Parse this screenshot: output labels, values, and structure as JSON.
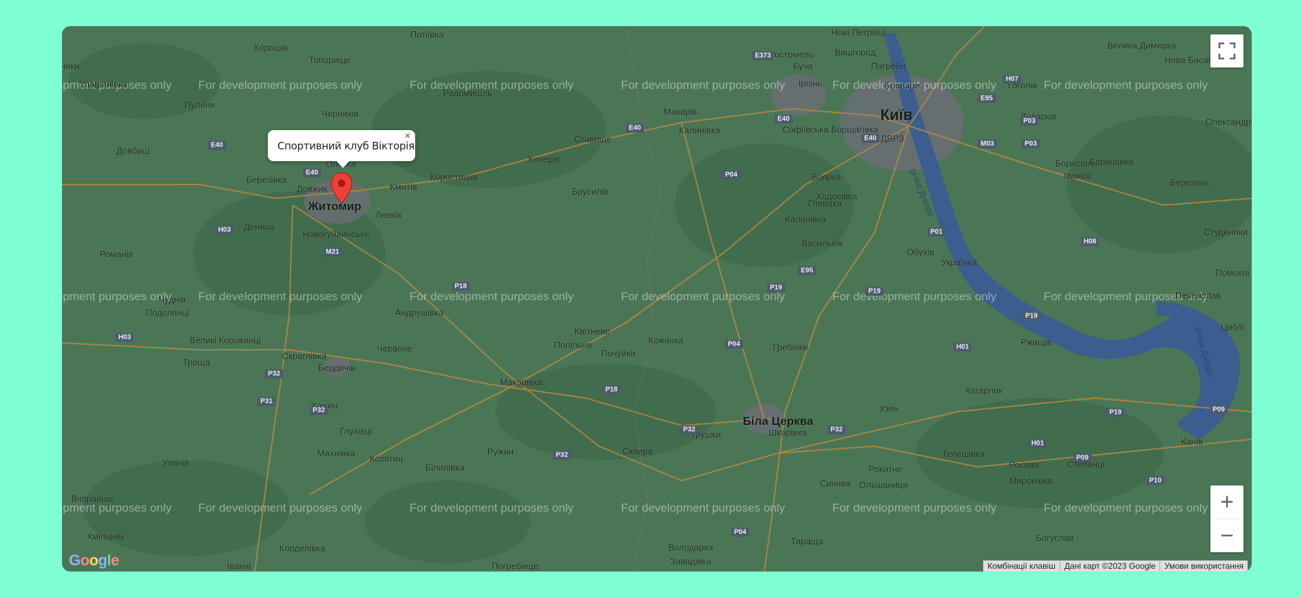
{
  "map": {
    "watermark": "For development purposes only",
    "colors": {
      "background": "#7fffd4",
      "land": "#4b7656",
      "water": "#3b5d8f",
      "urban": "#6d6d78",
      "road": "#b58a3e",
      "marker": "#ea4335"
    },
    "places": [
      {
        "name": "Потіївка",
        "type": "town"
      },
      {
        "name": "Хорошів",
        "type": "town"
      },
      {
        "name": "Топорище",
        "type": "town"
      },
      {
        "name": "Коростишів",
        "type": "town"
      },
      {
        "name": "Житомир",
        "type": "city"
      },
      {
        "name": "Київ",
        "type": "capital"
      },
      {
        "name": "Біла Церква",
        "type": "city"
      },
      {
        "name": "Нові Петрівці",
        "type": "town"
      },
      {
        "name": "Вишгород",
        "type": "town"
      },
      {
        "name": "Гостомель",
        "type": "town"
      },
      {
        "name": "Буча",
        "type": "town"
      },
      {
        "name": "Ірпінь",
        "type": "town"
      },
      {
        "name": "Погреби",
        "type": "town"
      },
      {
        "name": "Бровари",
        "type": "town"
      },
      {
        "name": "Велика Димерка",
        "type": "town"
      },
      {
        "name": "Нова Басань",
        "type": "town"
      },
      {
        "name": "Гоголів",
        "type": "town"
      },
      {
        "name": "Дударків",
        "type": "town"
      },
      {
        "name": "Софіївська Борщагівка",
        "type": "town"
      },
      {
        "name": "ДВРЗ",
        "type": "town"
      },
      {
        "name": "Бориспіль",
        "type": "town"
      },
      {
        "name": "Іванків",
        "type": "town"
      },
      {
        "name": "Баришівка",
        "type": "town"
      },
      {
        "name": "Березань",
        "type": "town"
      },
      {
        "name": "Олександрівка",
        "type": "town"
      },
      {
        "name": "Ходосівка",
        "type": "town"
      },
      {
        "name": "Боярка",
        "type": "town"
      },
      {
        "name": "Глеваха",
        "type": "town"
      },
      {
        "name": "Калинівка",
        "type": "town"
      },
      {
        "name": "Васильків",
        "type": "town"
      },
      {
        "name": "Обухів",
        "type": "town"
      },
      {
        "name": "Українка",
        "type": "town"
      },
      {
        "name": "Студеники",
        "type": "town"
      },
      {
        "name": "Переяслав",
        "type": "town"
      },
      {
        "name": "Помоклі",
        "type": "town"
      },
      {
        "name": "Циблі",
        "type": "town"
      },
      {
        "name": "Ржищів",
        "type": "town"
      },
      {
        "name": "Кагарлик",
        "type": "town"
      },
      {
        "name": "Канів",
        "type": "town"
      },
      {
        "name": "Узин",
        "type": "town"
      },
      {
        "name": "Гребінки",
        "type": "town"
      },
      {
        "name": "Шкарівка",
        "type": "town"
      },
      {
        "name": "Трушки",
        "type": "town"
      },
      {
        "name": "Кожанка",
        "type": "town"
      },
      {
        "name": "Почуйки",
        "type": "town"
      },
      {
        "name": "Квітневе",
        "type": "town"
      },
      {
        "name": "Попільня",
        "type": "town"
      },
      {
        "name": "Сквира",
        "type": "town"
      },
      {
        "name": "Макарівка",
        "type": "town"
      },
      {
        "name": "Ружин",
        "type": "town"
      },
      {
        "name": "Білилівка",
        "type": "town"
      },
      {
        "name": "Козятин",
        "type": "town"
      },
      {
        "name": "Махнівка",
        "type": "town"
      },
      {
        "name": "Глухівці",
        "type": "town"
      },
      {
        "name": "Хажин",
        "type": "town"
      },
      {
        "name": "Бердичів",
        "type": "town"
      },
      {
        "name": "Скраглівка",
        "type": "town"
      },
      {
        "name": "Червоне",
        "type": "town"
      },
      {
        "name": "Андрушівка",
        "type": "town"
      },
      {
        "name": "Брусилів",
        "type": "town"
      },
      {
        "name": "Ставище",
        "type": "town"
      },
      {
        "name": "Кочерів",
        "type": "town"
      },
      {
        "name": "Макарів",
        "type": "town"
      },
      {
        "name": "Калинівка",
        "type": "town"
      },
      {
        "name": "Радомишль",
        "type": "town"
      },
      {
        "name": "Черняхів",
        "type": "town"
      },
      {
        "name": "Пулини",
        "type": "town"
      },
      {
        "name": "Улашанівка",
        "type": "town"
      },
      {
        "name": "Броники",
        "type": "town"
      },
      {
        "name": "Довбиш",
        "type": "town"
      },
      {
        "name": "Березівка",
        "type": "town"
      },
      {
        "name": "Довжик",
        "type": "town"
      },
      {
        "name": "Оліївка",
        "type": "town"
      },
      {
        "name": "Кмитів",
        "type": "town"
      },
      {
        "name": "Левків",
        "type": "town"
      },
      {
        "name": "Новогуйвинське",
        "type": "town"
      },
      {
        "name": "Дениші",
        "type": "town"
      },
      {
        "name": "Романів",
        "type": "town"
      },
      {
        "name": "Чуднів",
        "type": "town"
      },
      {
        "name": "Подолянці",
        "type": "town"
      },
      {
        "name": "Великі Коровинці",
        "type": "town"
      },
      {
        "name": "Троща",
        "type": "town"
      },
      {
        "name": "Улянів",
        "type": "town"
      },
      {
        "name": "Вчорайше",
        "type": "town"
      },
      {
        "name": "Хмільник",
        "type": "town"
      },
      {
        "name": "Корделівка",
        "type": "town"
      },
      {
        "name": "Іванів",
        "type": "town"
      },
      {
        "name": "Погребище",
        "type": "town"
      },
      {
        "name": "Володарка",
        "type": "town"
      },
      {
        "name": "Завадівка",
        "type": "town"
      },
      {
        "name": "Тараща",
        "type": "town"
      },
      {
        "name": "Ольшаниця",
        "type": "town"
      },
      {
        "name": "Синява",
        "type": "town"
      },
      {
        "name": "Рокитне",
        "type": "town"
      },
      {
        "name": "Телешівка",
        "type": "town"
      },
      {
        "name": "Росава",
        "type": "town"
      },
      {
        "name": "Миронівка",
        "type": "town"
      },
      {
        "name": "Степанці",
        "type": "town"
      },
      {
        "name": "Богуслав",
        "type": "town"
      }
    ],
    "water_labels": [
      "річка Дніпро",
      "річка Дніпро"
    ],
    "road_shields": [
      "E373",
      "E40",
      "E40",
      "E40",
      "E40",
      "E40",
      "E95",
      "E95",
      "H07",
      "P03",
      "P03",
      "M03",
      "P01",
      "H08",
      "P04",
      "P04",
      "P04",
      "P19",
      "P19",
      "P19",
      "P19",
      "P18",
      "P18",
      "P32",
      "P32",
      "P32",
      "P32",
      "P32",
      "P31",
      "H03",
      "H03",
      "M21",
      "P09",
      "P09",
      "P10",
      "H01",
      "H01"
    ],
    "marker": {
      "name": "Спортивний клуб Вікторія"
    }
  },
  "infowindow": {
    "text": "Спортивний клуб Вікторія",
    "close_label": "×"
  },
  "controls": {
    "fullscreen_icon": "fullscreen-icon",
    "zoom_in_label": "+",
    "zoom_out_label": "−"
  },
  "attribution": {
    "shortcuts": "Комбінації клавіш",
    "data": "Дані карт ©2023 Google",
    "terms": "Умови використання"
  },
  "logo": {
    "text": "Google"
  }
}
